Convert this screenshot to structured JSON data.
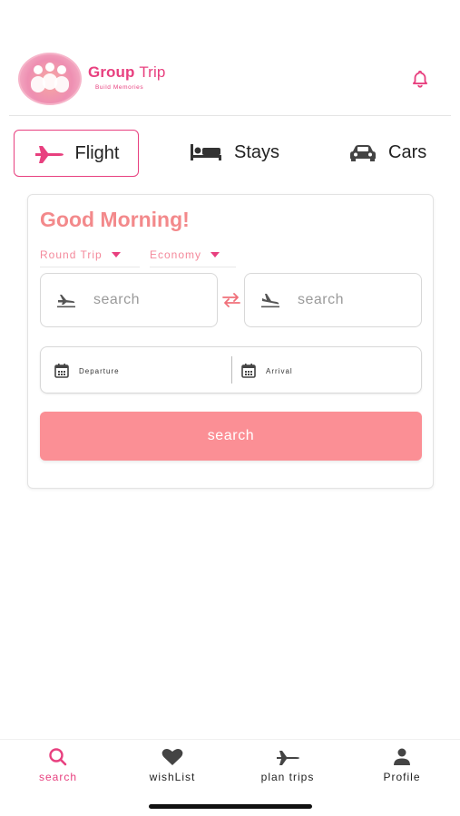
{
  "brand": {
    "title_bold": "Group",
    "title_light": "Trip",
    "tagline": "Build Memories"
  },
  "tabs": [
    {
      "label": "Flight",
      "icon": "airplane-icon",
      "active": true
    },
    {
      "label": "Stays",
      "icon": "bed-icon",
      "active": false
    },
    {
      "label": "Cars",
      "icon": "car-icon",
      "active": false
    }
  ],
  "search_card": {
    "greeting": "Good Morning!",
    "trip_type": "Round Trip",
    "cabin_class": "Economy",
    "from": {
      "placeholder": "search",
      "icon": "flight-departure-icon"
    },
    "to": {
      "placeholder": "search",
      "icon": "flight-landing-icon"
    },
    "swap_icon": "swap-arrows-icon",
    "departure_label": "Departure",
    "arrival_label": "Arrival",
    "search_button": "search"
  },
  "bottom_nav": [
    {
      "label": "search",
      "icon": "search-icon",
      "active": true
    },
    {
      "label": "wishList",
      "icon": "heart-icon",
      "active": false
    },
    {
      "label": "plan trips",
      "icon": "airplane-icon",
      "active": false
    },
    {
      "label": "Profile",
      "icon": "person-icon",
      "active": false
    }
  ],
  "colors": {
    "accent": "#e8407f",
    "greeting": "#f3898b",
    "button": "#fb8f95"
  }
}
